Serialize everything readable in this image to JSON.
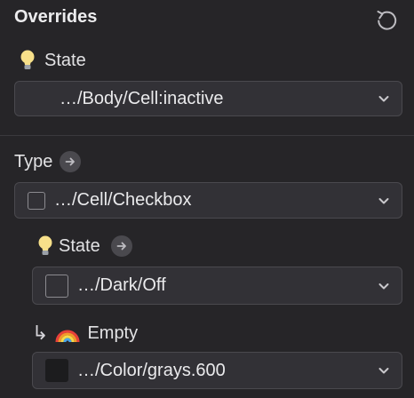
{
  "panel": {
    "title": "Overrides"
  },
  "state_section": {
    "label": "State",
    "value": "…/Body/Cell:inactive"
  },
  "type_section": {
    "label": "Type",
    "value": "…/Cell/Checkbox"
  },
  "nested_state": {
    "label": "State",
    "value": "…/Dark/Off"
  },
  "empty_section": {
    "arrow_glyph": "↳",
    "label": "Empty",
    "value": "…/Color/grays.600"
  },
  "icons": {
    "reset": "reset-icon",
    "bulb": "lightbulb-icon",
    "arrow": "arrow-right-icon",
    "chevron": "chevron-down-icon",
    "rainbow": "rainbow-icon"
  },
  "colors": {
    "background": "#262528",
    "dropdown_bg": "#323136",
    "dropdown_border": "#4a494e",
    "swatch_fill": "#1c1c1e"
  }
}
